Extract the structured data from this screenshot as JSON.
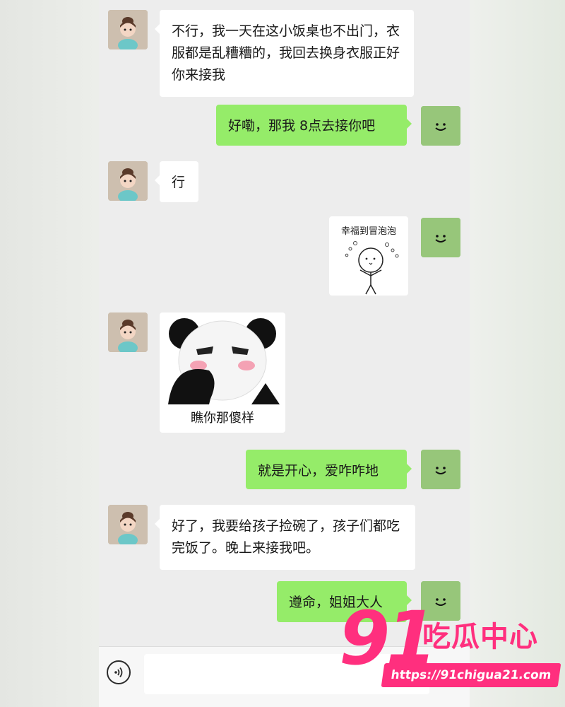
{
  "messages": [
    {
      "from": "them",
      "type": "text",
      "text": "不行，我一天在这小饭桌也不出门，衣服都是乱糟糟的，我回去换身衣服正好你来接我"
    },
    {
      "from": "me",
      "type": "text",
      "text": "好嘞，那我 8点去接你吧"
    },
    {
      "from": "them",
      "type": "text",
      "text": "行"
    },
    {
      "from": "me",
      "type": "sticker",
      "sticker_text": "幸福到冒泡泡",
      "sticker_icon": "stick-figure-bubbles"
    },
    {
      "from": "them",
      "type": "sticker",
      "sticker_text": "瞧你那傻样",
      "sticker_icon": "panda-face-blush"
    },
    {
      "from": "me",
      "type": "text",
      "text": "就是开心，爱咋咋地"
    },
    {
      "from": "them",
      "type": "text",
      "text": "好了，我要给孩子捡碗了，孩子们都吃完饭了。晚上来接我吧。"
    },
    {
      "from": "me",
      "type": "text",
      "text": "遵命，姐姐大人"
    }
  ],
  "input_bar": {
    "voice_icon": "voice-icon",
    "placeholder": ""
  },
  "watermark": {
    "number": "91",
    "title": "吃瓜中心",
    "url": "https://91chigua21.com"
  },
  "colors": {
    "accent": "#95ec69",
    "bubble_in": "#ffffff",
    "chat_bg": "#ededed",
    "watermark": "#ff2f7e"
  }
}
